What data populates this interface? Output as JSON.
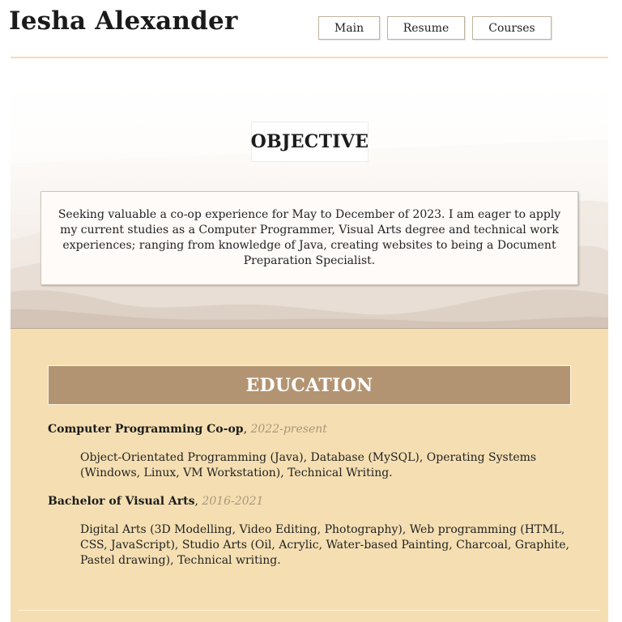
{
  "header": {
    "name": "Iesha Alexander",
    "nav": [
      {
        "label": "Main"
      },
      {
        "label": "Resume"
      },
      {
        "label": "Courses"
      }
    ]
  },
  "objective": {
    "title": "OBJECTIVE",
    "text": "Seeking valuable a co-op experience for May to December of 2023. I am eager to apply my current studies as a Computer Programmer, Visual Arts degree and technical work experiences; ranging from knowledge of Java, creating websites to being a Document Preparation Specialist."
  },
  "education": {
    "title": "EDUCATION",
    "entries": [
      {
        "degree": "Computer Programming Co-op",
        "years": "2022-present",
        "description": "Object-Orientated Programming (Java), Database (MySQL), Operating Systems (Windows, Linux, VM Workstation), Technical Writing."
      },
      {
        "degree": "Bachelor of Visual Arts",
        "years": "2016-2021",
        "description": "Digital Arts (3D Modelling, Video Editing, Photography), Web programming (HTML, CSS, JavaScript), Studio Arts (Oil, Acrylic, Water-based Painting, Charcoal, Graphite, Pastel drawing), Technical writing."
      }
    ]
  },
  "colors": {
    "accent_rule": "#f3ddb0",
    "education_bg": "#f5dfb2",
    "education_heading_bg": "#b39472",
    "years_text": "#a8957b"
  }
}
